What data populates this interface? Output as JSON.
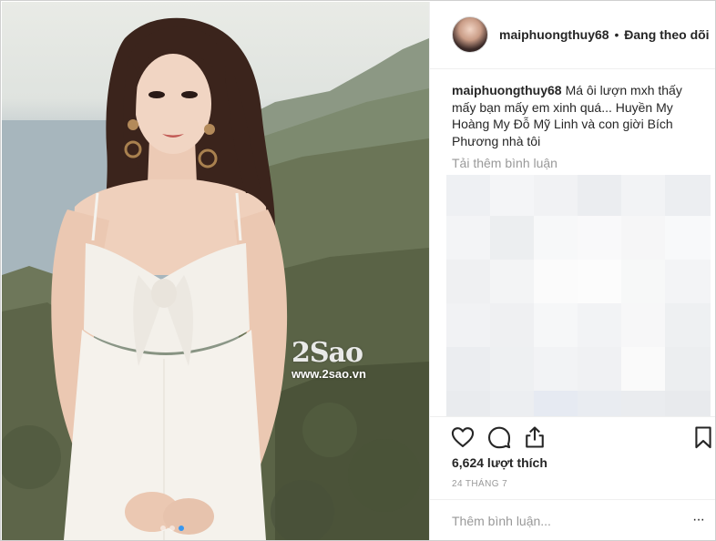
{
  "post": {
    "watermark_logo": "2Sao",
    "watermark_url": "www.2sao.vn",
    "carousel_count": 3,
    "carousel_active": 2
  },
  "header": {
    "username": "maiphuongthuy68",
    "separator": "•",
    "follow_status": "Đang theo dõi"
  },
  "caption": {
    "username": "maiphuongthuy68",
    "text": "Má ôi lượn mxh thấy mấy bạn mấy em xinh quá... Huyền My Hoàng My Đỗ Mỹ Linh và con giời Bích Phương nhà tôi"
  },
  "comments": {
    "load_more": "Tải thêm bình luận"
  },
  "actions": {
    "like_icon": "heart-icon",
    "comment_icon": "comment-icon",
    "share_icon": "share-icon",
    "save_icon": "bookmark-icon",
    "likes": "6,624 lượt thích",
    "date": "24 THÁNG 7"
  },
  "comment_box": {
    "placeholder": "Thêm bình luận...",
    "more": "···"
  },
  "colors": {
    "accent": "#3897f0",
    "text": "#262626",
    "muted": "#999999",
    "border": "#efefef"
  }
}
